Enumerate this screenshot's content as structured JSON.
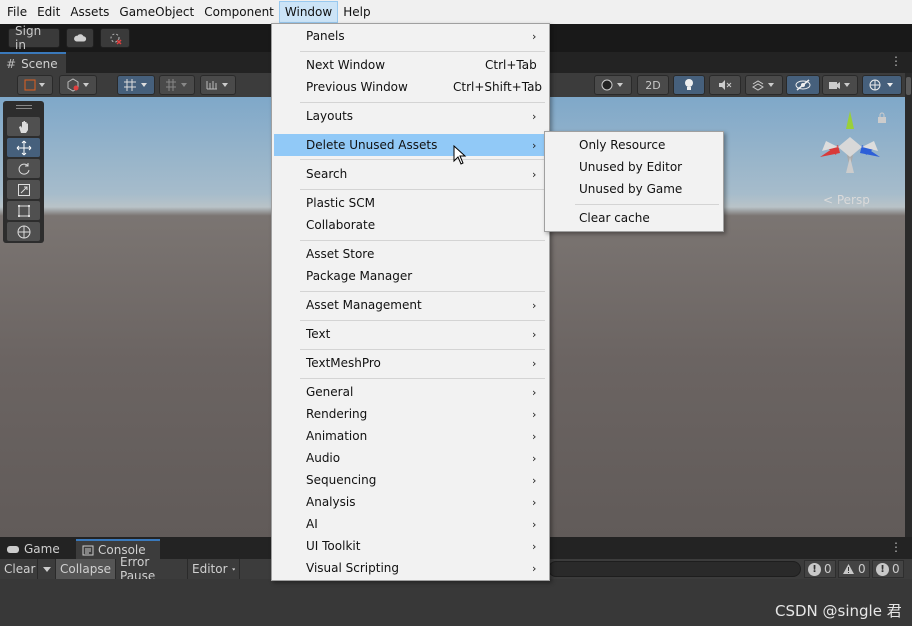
{
  "menubar": {
    "items": [
      "File",
      "Edit",
      "Assets",
      "GameObject",
      "Component",
      "Window",
      "Help"
    ]
  },
  "toolbar": {
    "sign_in": "Sign in"
  },
  "scene": {
    "tab_label": "Scene",
    "toggle_2d": "2D",
    "persp_label": "< Persp"
  },
  "window_menu": {
    "items": [
      {
        "label": "Panels",
        "submenu": true
      },
      {
        "label": "Next Window",
        "shortcut": "Ctrl+Tab"
      },
      {
        "label": "Previous Window",
        "shortcut": "Ctrl+Shift+Tab"
      },
      {
        "label": "Layouts",
        "submenu": true
      },
      {
        "label": "Delete Unused Assets",
        "submenu": true,
        "highlighted": true
      },
      {
        "label": "Search",
        "submenu": true
      },
      {
        "label": "Plastic SCM"
      },
      {
        "label": "Collaborate"
      },
      {
        "label": "Asset Store"
      },
      {
        "label": "Package Manager"
      },
      {
        "label": "Asset Management",
        "submenu": true
      },
      {
        "label": "Text",
        "submenu": true
      },
      {
        "label": "TextMeshPro",
        "submenu": true
      },
      {
        "label": "General",
        "submenu": true
      },
      {
        "label": "Rendering",
        "submenu": true
      },
      {
        "label": "Animation",
        "submenu": true
      },
      {
        "label": "Audio",
        "submenu": true
      },
      {
        "label": "Sequencing",
        "submenu": true
      },
      {
        "label": "Analysis",
        "submenu": true
      },
      {
        "label": "AI",
        "submenu": true
      },
      {
        "label": "UI Toolkit",
        "submenu": true
      },
      {
        "label": "Visual Scripting",
        "submenu": true
      }
    ]
  },
  "submenu": {
    "items": [
      "Only Resource",
      "Unused by Editor",
      "Unused by Game",
      "Clear cache"
    ]
  },
  "bottom": {
    "tabs": [
      "Game",
      "Console"
    ],
    "console_buttons": [
      "Clear",
      "Collapse",
      "Error Pause",
      "Editor"
    ],
    "counts": {
      "info": "0",
      "warnings": "0",
      "errors": "0"
    }
  },
  "watermark": "CSDN @single 君",
  "colors": {
    "menu_highlight": "#91c9f7",
    "active_tab_accent": "#3a79bb",
    "menubar_bg": "#f0f0f0"
  }
}
